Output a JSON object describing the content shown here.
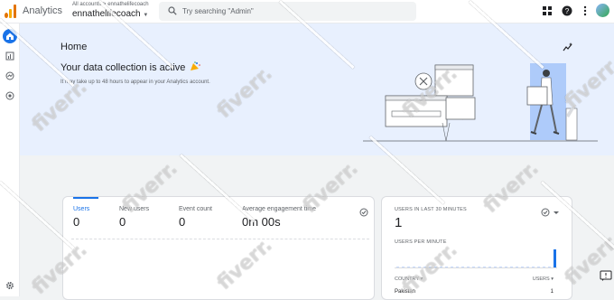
{
  "app": {
    "name": "Analytics"
  },
  "header": {
    "breadcrumb_root": "All accounts",
    "breadcrumb_separator": ">",
    "breadcrumb_account": "ennathelifecoach",
    "account_name": "ennathelifecoach",
    "search_placeholder": "Try searching \"Admin\""
  },
  "hero": {
    "title": "Home",
    "heading": "Your data collection is active",
    "subtitle": "It may take up to 48 hours to appear in your Analytics account."
  },
  "metrics": [
    {
      "label": "Users",
      "value": "0"
    },
    {
      "label": "New users",
      "value": "0"
    },
    {
      "label": "Event count",
      "value": "0"
    },
    {
      "label": "Average engagement time",
      "value": "0m 00s"
    }
  ],
  "realtime": {
    "users_label": "USERS IN LAST 30 MINUTES",
    "users_value": "1",
    "per_minute_label": "USERS PER MINUTE",
    "per_minute_values": [
      0,
      0,
      0,
      0,
      0,
      0,
      0,
      0,
      0,
      0,
      0,
      0,
      0,
      0,
      0,
      0,
      0,
      0,
      0,
      0,
      0,
      0,
      0,
      0,
      0,
      0,
      0,
      0,
      0,
      1
    ],
    "col_country": "COUNTRY",
    "col_users": "USERS",
    "rows": [
      {
        "country": "Pakistan",
        "users": "1"
      }
    ]
  },
  "watermark_text": "fiverr.",
  "colors": {
    "accent": "#1a73e8",
    "hero_bg": "#e8f0fe",
    "logo_orange": "#f9ab00",
    "logo_dark": "#e37400"
  }
}
